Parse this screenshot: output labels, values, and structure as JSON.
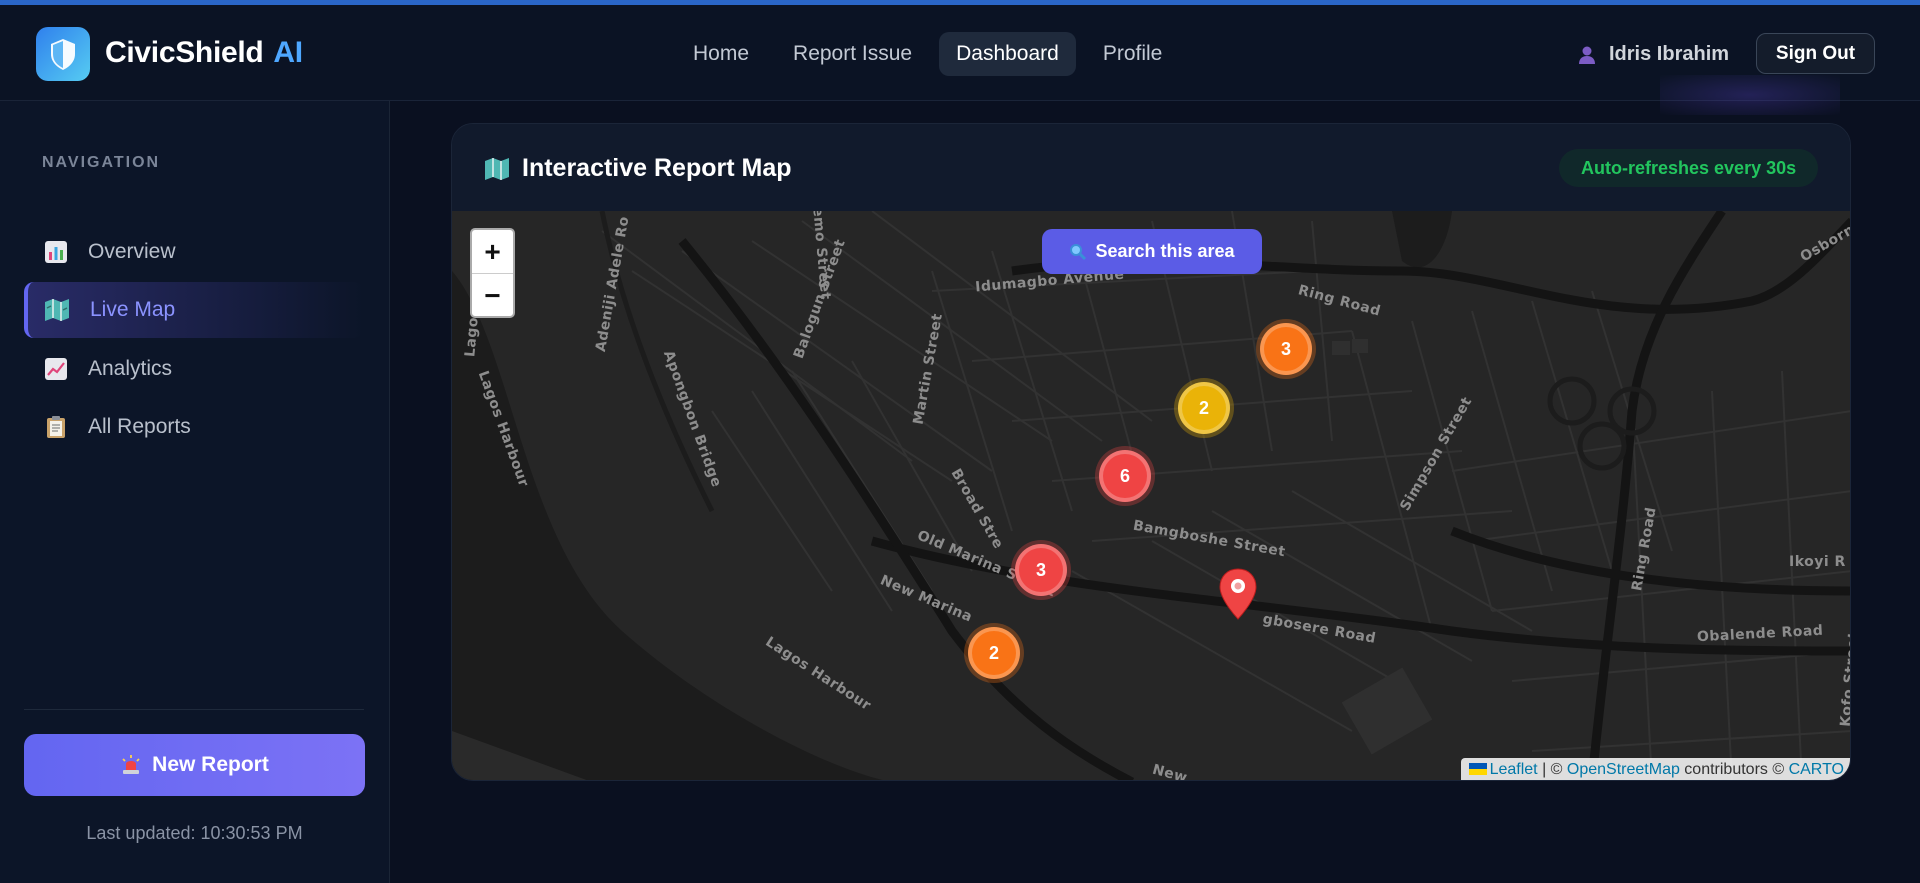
{
  "header": {
    "brand_name": "CivicShield",
    "brand_suffix": "AI",
    "nav": [
      {
        "label": "Home",
        "active": false
      },
      {
        "label": "Report Issue",
        "active": false
      },
      {
        "label": "Dashboard",
        "active": true
      },
      {
        "label": "Profile",
        "active": false
      }
    ],
    "user_name": "Idris Ibrahim",
    "signout_label": "Sign Out"
  },
  "sidebar": {
    "section_title": "NAVIGATION",
    "items": [
      {
        "label": "Overview",
        "icon": "bar-chart-icon",
        "active": false
      },
      {
        "label": "Live Map",
        "icon": "map-icon",
        "active": true
      },
      {
        "label": "Analytics",
        "icon": "trend-chart-icon",
        "active": false
      },
      {
        "label": "All Reports",
        "icon": "clipboard-icon",
        "active": false
      }
    ],
    "new_report_label": "New Report",
    "new_report_icon": "siren-icon",
    "last_updated": "Last updated: 10:30:53 PM"
  },
  "map_card": {
    "title": "Interactive Report Map",
    "title_icon": "map-icon",
    "refresh_badge": "Auto-refreshes every 30s",
    "search_area_label": "Search this area",
    "zoom_in": "+",
    "zoom_out": "−",
    "clusters": [
      {
        "count": "3",
        "severity": "orange"
      },
      {
        "count": "2",
        "severity": "yellow"
      },
      {
        "count": "6",
        "severity": "red"
      },
      {
        "count": "3",
        "severity": "red"
      },
      {
        "count": "2",
        "severity": "orange"
      }
    ],
    "street_labels": [
      "Idumagbo Avenue",
      "Ring Road",
      "Bamgboshe Street",
      "Old Marina Street",
      "New Marina",
      "Lagos Harbour",
      "Simpson Street",
      "Obalende Road",
      "Ikoyi R",
      "Osborne",
      "Adeniji Adele Ro",
      "Apongbon Bridge",
      "Balogun Street",
      "Martin Street",
      "Broad Stre",
      "Lagos Harbour",
      "Ring Road",
      "gbosere Road",
      "Kofo Street",
      "Lago",
      "cemo Street",
      "New"
    ],
    "attribution": {
      "leaflet": "Leaflet",
      "sep": " | © ",
      "osm": "OpenStreetMap",
      "contrib": " contributors © ",
      "carto": "CARTO"
    }
  },
  "colors": {
    "accent": "#6366f1",
    "brand_blue": "#4ea7ff",
    "success": "#22c55e",
    "cluster_orange": "#f97316",
    "cluster_yellow": "#eab308",
    "cluster_red": "#ef4444"
  }
}
